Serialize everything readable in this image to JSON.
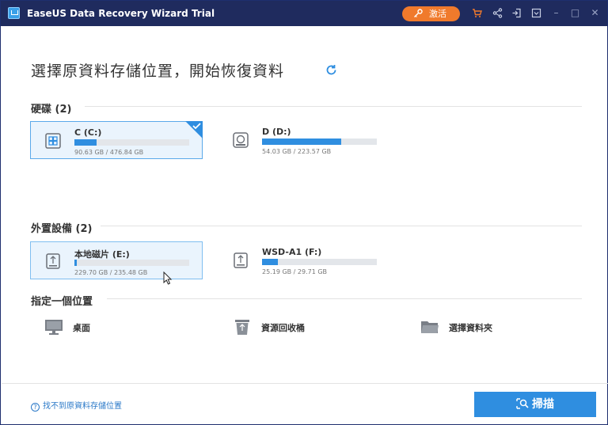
{
  "window": {
    "title": "EaseUS Data Recovery Wizard Trial"
  },
  "titlebar": {
    "activate_label": "激活",
    "icons": [
      "key-icon",
      "cart-icon",
      "share-icon",
      "login-icon",
      "menu-icon"
    ],
    "window_controls": [
      "minimize",
      "maximize",
      "close"
    ]
  },
  "main": {
    "heading": "選擇原資料存儲位置，開始恢復資料",
    "hard_disks": {
      "label": "硬碟 (2)",
      "drives": [
        {
          "name": "C (C:)",
          "size": "90.63 GB / 476.84 GB",
          "used_fraction": 0.19,
          "selected": true,
          "icon": "windows-drive-icon"
        },
        {
          "name": "D (D:)",
          "size": "54.03 GB / 223.57 GB",
          "used_fraction": 0.69,
          "selected": false,
          "icon": "hdd-icon"
        }
      ]
    },
    "external": {
      "label": "外置設備 (2)",
      "drives": [
        {
          "name": "本地磁片 (E:)",
          "size": "229.70 GB / 235.48 GB",
          "used_fraction": 0.02,
          "selected": false,
          "hovered": true,
          "icon": "usb-drive-icon"
        },
        {
          "name": "WSD-A1 (F:)",
          "size": "25.19 GB / 29.71 GB",
          "used_fraction": 0.14,
          "selected": false,
          "icon": "usb-drive-icon"
        }
      ]
    },
    "locations": {
      "label": "指定一個位置",
      "items": [
        {
          "label": "桌面",
          "icon": "monitor-icon"
        },
        {
          "label": "資源回收桶",
          "icon": "recycle-bin-icon"
        },
        {
          "label": "選擇資料夾",
          "icon": "folder-icon"
        }
      ]
    }
  },
  "footer": {
    "help_link": "找不到原資料存儲位置",
    "scan_button": "掃描"
  },
  "colors": {
    "titlebar": "#1f2b5e",
    "accent": "#2f8ee0",
    "activate": "#f07a2c",
    "selected_bg": "#eaf4fd"
  }
}
